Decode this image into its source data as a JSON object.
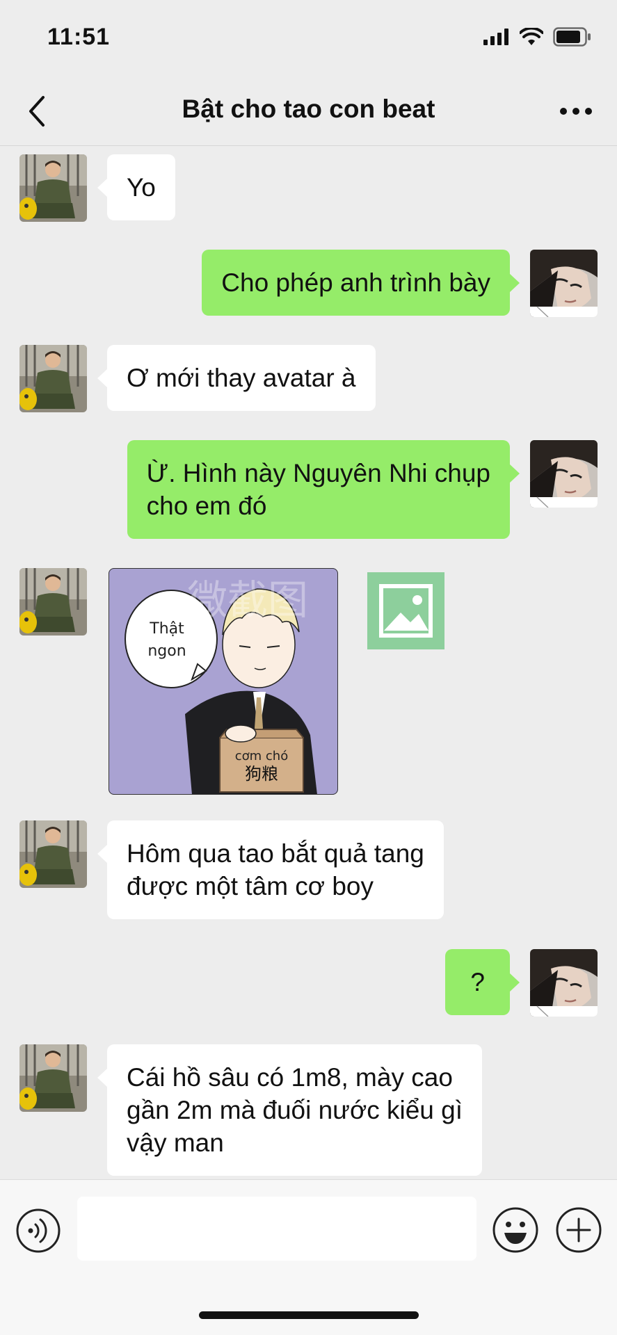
{
  "status_bar": {
    "time": "11:51",
    "icons": [
      "signal-icon",
      "wifi-icon",
      "battery-icon"
    ]
  },
  "nav": {
    "title": "Bật cho tao con beat",
    "back_icon": "chevron-left-icon",
    "more_icon": "more-dots-icon"
  },
  "messages": [
    {
      "side": "in",
      "type": "text",
      "text": "Yo"
    },
    {
      "side": "out",
      "type": "text",
      "text": "Cho phép anh trình bày"
    },
    {
      "side": "in",
      "type": "text",
      "text": "Ơ mới thay avatar à"
    },
    {
      "side": "out",
      "type": "text",
      "lines": [
        "Ừ. Hình này Nguyên Nhi chụp",
        "cho em đó"
      ]
    },
    {
      "side": "in",
      "type": "sticker",
      "speech": [
        "Thật",
        "ngon"
      ],
      "bag_top": "cơm chó",
      "bag_bottom": "狗粮",
      "watermark": "微截图"
    },
    {
      "side": "in",
      "type": "text",
      "lines": [
        "Hôm qua tao bắt quả tang",
        "được một tâm cơ boy"
      ]
    },
    {
      "side": "out",
      "type": "text",
      "text": "?"
    },
    {
      "side": "in",
      "type": "text",
      "lines": [
        "Cái hồ sâu có 1m8, mày cao",
        "gần 2m mà đuối nước kiểu gì",
        "vậy man"
      ]
    }
  ],
  "input_bar": {
    "voice_icon": "voice-icon",
    "text_value": "",
    "emoji_icon": "emoji-icon",
    "plus_icon": "plus-icon"
  },
  "colors": {
    "background": "#ededed",
    "incoming_bubble": "#ffffff",
    "outgoing_bubble": "#95ec69"
  }
}
